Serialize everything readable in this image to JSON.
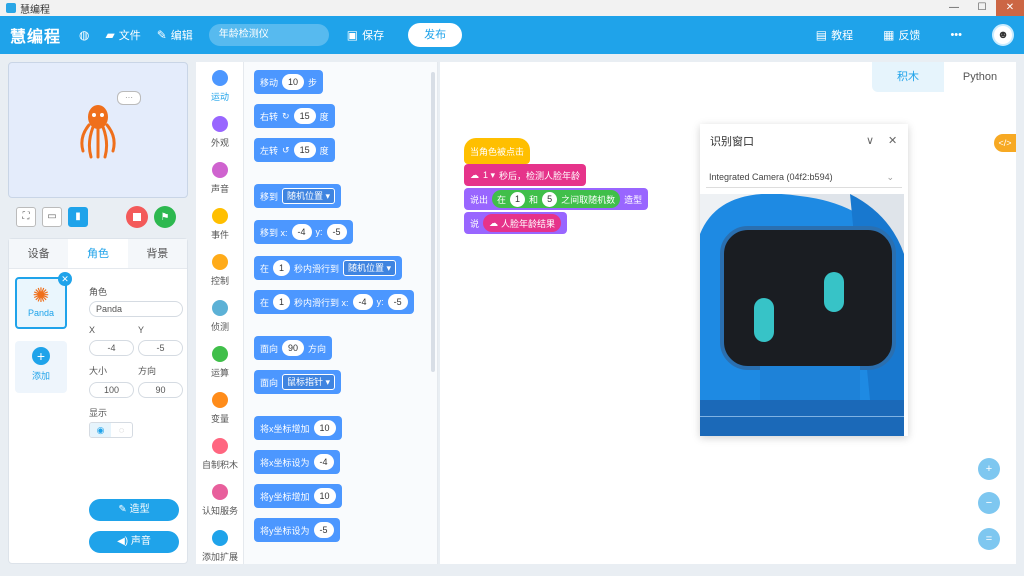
{
  "window": {
    "title": "慧编程"
  },
  "menubar": {
    "logo": "慧编程",
    "file": "文件",
    "edit": "编辑",
    "project_name": "年龄检测仪",
    "save": "保存",
    "publish": "发布",
    "tutorial": "教程",
    "feedback": "反馈",
    "more": "•••"
  },
  "left_panel": {
    "tabs": [
      "设备",
      "角色",
      "背景"
    ],
    "active_tab": "角色",
    "sprite_name": "Panda",
    "add_label": "添加",
    "props": {
      "role_label": "角色",
      "role_value": "Panda",
      "x_label": "X",
      "y_label": "Y",
      "x_value": "-4",
      "y_value": "-5",
      "size_label": "大小",
      "direction_label": "方向",
      "size_value": "100",
      "direction_value": "90",
      "show_label": "显示"
    },
    "costume_button": "造型",
    "sound_button": "声音"
  },
  "categories": [
    {
      "label": "运动",
      "color": "#4c97ff"
    },
    {
      "label": "外观",
      "color": "#9966ff"
    },
    {
      "label": "声音",
      "color": "#cf63cf"
    },
    {
      "label": "事件",
      "color": "#ffbf00"
    },
    {
      "label": "控制",
      "color": "#ffab19"
    },
    {
      "label": "侦测",
      "color": "#5cb1d6"
    },
    {
      "label": "运算",
      "color": "#40bf4a"
    },
    {
      "label": "变量",
      "color": "#ff8c1a"
    },
    {
      "label": "自制积木",
      "color": "#ff6680"
    },
    {
      "label": "认知服务",
      "color": "#e85f9c"
    },
    {
      "label": "添加扩展",
      "color": "#1fa3ea"
    }
  ],
  "palette": {
    "move": {
      "a": "移动",
      "v": "10",
      "b": "步"
    },
    "turn_right": {
      "a": "右转",
      "v": "15",
      "b": "度"
    },
    "turn_left": {
      "a": "左转",
      "v": "15",
      "b": "度"
    },
    "goto": {
      "a": "移到",
      "sel": "随机位置 ▾"
    },
    "goto_xy": {
      "a": "移到 x:",
      "x": "-4",
      "b": "y:",
      "y": "-5"
    },
    "glide": {
      "a": "在",
      "v": "1",
      "b": "秒内滑行到",
      "sel": "随机位置 ▾"
    },
    "glide_xy": {
      "a": "在",
      "v": "1",
      "b": "秒内滑行到 x:",
      "x": "-4",
      "c": "y:",
      "y": "-5"
    },
    "point_dir": {
      "a": "面向",
      "v": "90",
      "b": "方向"
    },
    "point_towards": {
      "a": "面向",
      "sel": "鼠标指针 ▾"
    },
    "change_x": {
      "a": "将x坐标增加",
      "v": "10"
    },
    "set_x": {
      "a": "将x坐标设为",
      "v": "-4"
    },
    "change_y": {
      "a": "将y坐标增加",
      "v": "10"
    },
    "set_y": {
      "a": "将y坐标设为",
      "v": "-5"
    }
  },
  "workspace": {
    "tabs": [
      "积木",
      "Python"
    ],
    "active_tab": "积木",
    "script": {
      "hat": "当角色被点击",
      "detect": {
        "v": "1 ▾",
        "b": "秒后，检测人脸年龄"
      },
      "say_random": {
        "a": "说出",
        "b": "在",
        "v1": "1",
        "c": "和",
        "v2": "5",
        "d": "之间取随机数",
        "e": "造型"
      },
      "say": {
        "a": "说",
        "b": "人脸年龄结果"
      }
    },
    "code_toggle": "</>"
  },
  "recognition": {
    "title": "识别窗口",
    "camera": "Integrated Camera (04f2:b594)"
  }
}
